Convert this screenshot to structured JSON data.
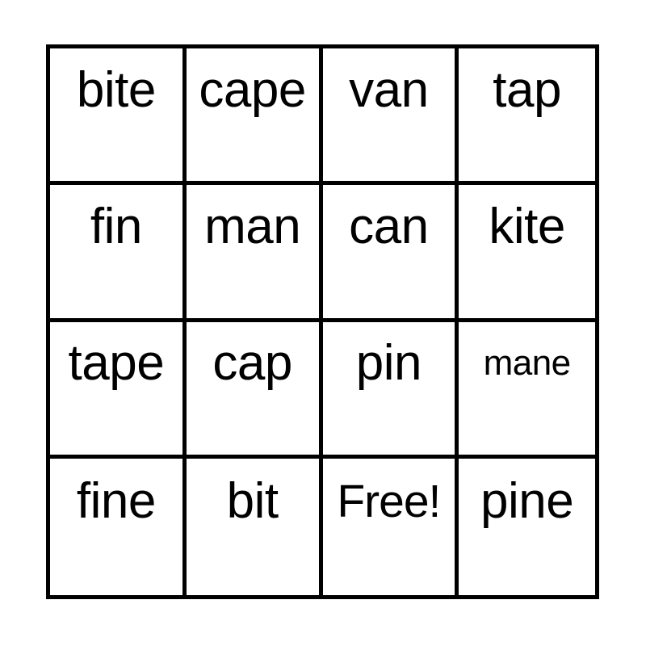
{
  "card": {
    "type": "bingo-card",
    "columns": 4,
    "rows": 4,
    "border_color": "#000000",
    "background_color": "#ffffff",
    "text_color": "#000000",
    "free_space_label": "Free!",
    "cells": [
      {
        "label": "bite",
        "size": "normal"
      },
      {
        "label": "cape",
        "size": "normal"
      },
      {
        "label": "van",
        "size": "normal"
      },
      {
        "label": "tap",
        "size": "normal"
      },
      {
        "label": "fin",
        "size": "normal"
      },
      {
        "label": "man",
        "size": "normal"
      },
      {
        "label": "can",
        "size": "normal"
      },
      {
        "label": "kite",
        "size": "normal"
      },
      {
        "label": "tape",
        "size": "normal"
      },
      {
        "label": "cap",
        "size": "normal"
      },
      {
        "label": "pin",
        "size": "normal"
      },
      {
        "label": "mane",
        "size": "small"
      },
      {
        "label": "fine",
        "size": "normal"
      },
      {
        "label": "bit",
        "size": "normal"
      },
      {
        "label": "Free!",
        "size": "fit"
      },
      {
        "label": "pine",
        "size": "normal"
      }
    ]
  }
}
